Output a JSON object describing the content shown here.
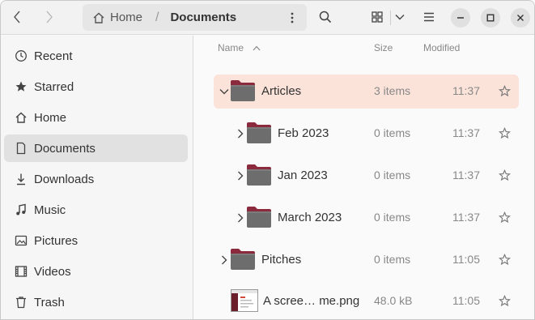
{
  "header": {
    "back_icon": "chevron-left-icon",
    "forward_icon": "chevron-right-icon",
    "path": {
      "home_label": "Home",
      "separator": "/",
      "current": "Documents"
    },
    "icons": [
      "home-icon",
      "kebab-menu-icon",
      "search-icon",
      "grid-view-icon",
      "chevron-down-icon",
      "hamburger-menu-icon",
      "minimize-icon",
      "maximize-icon",
      "close-icon"
    ]
  },
  "sidebar": {
    "items": [
      {
        "label": "Recent",
        "icon": "clock-icon"
      },
      {
        "label": "Starred",
        "icon": "star-icon"
      },
      {
        "label": "Home",
        "icon": "home-icon"
      },
      {
        "label": "Documents",
        "icon": "document-icon",
        "active": true
      },
      {
        "label": "Downloads",
        "icon": "download-icon"
      },
      {
        "label": "Music",
        "icon": "music-note-icon"
      },
      {
        "label": "Pictures",
        "icon": "picture-icon"
      },
      {
        "label": "Videos",
        "icon": "video-icon"
      },
      {
        "label": "Trash",
        "icon": "trash-icon"
      }
    ]
  },
  "list": {
    "columns": {
      "name": "Name",
      "size": "Size",
      "modified": "Modified",
      "sort_icon": "sort-ascending-icon"
    },
    "rows": [
      {
        "name": "Articles",
        "size": "3 items",
        "modified": "11:37",
        "expanded": true,
        "selected": true,
        "level": 0,
        "type": "folder"
      },
      {
        "name": "Feb 2023",
        "size": "0 items",
        "modified": "11:37",
        "expanded": false,
        "level": 1,
        "type": "folder"
      },
      {
        "name": "Jan 2023",
        "size": "0 items",
        "modified": "11:37",
        "expanded": false,
        "level": 1,
        "type": "folder"
      },
      {
        "name": "March 2023",
        "size": "0 items",
        "modified": "11:37",
        "expanded": false,
        "level": 1,
        "type": "folder"
      },
      {
        "name": "Pitches",
        "size": "0 items",
        "modified": "11:05",
        "expanded": false,
        "level": 0,
        "type": "folder"
      },
      {
        "name": "A scree… me.png",
        "size": "48.0 kB",
        "modified": "11:05",
        "level": 0,
        "type": "image"
      }
    ]
  },
  "colors": {
    "selection": "#fbe3da",
    "folder_body": "#6d6d6d",
    "folder_tab": "#8a2a3c",
    "accent_star": "#777777"
  }
}
